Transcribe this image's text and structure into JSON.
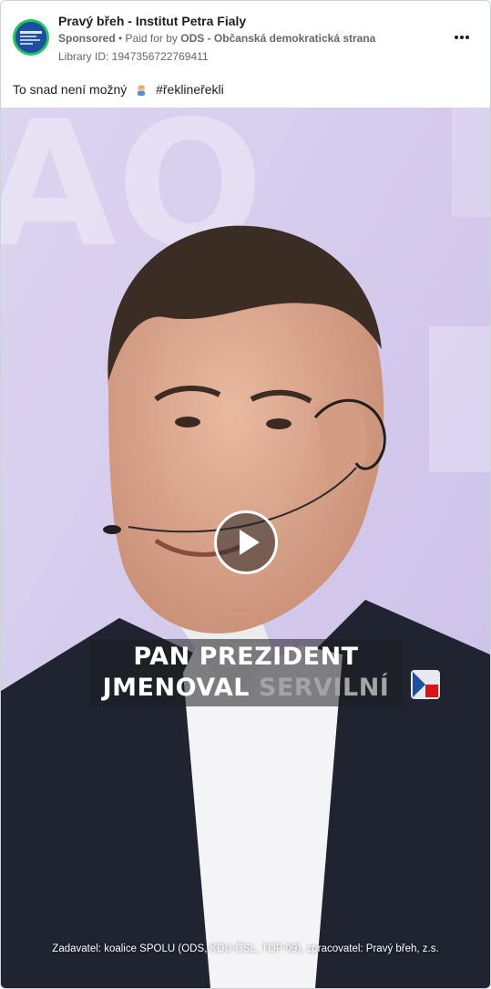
{
  "ad": {
    "page_name": "Pravý břeh - Institut Petra Fialy",
    "sponsored_label": "Sponsored",
    "separator": " • ",
    "paid_for_prefix": "Paid for by ",
    "payer": "ODS - Občanská demokratická strana",
    "library_id": "Library ID: 1947356722769411",
    "caption_text_before": "To snad není možný",
    "caption_hashtag": "#řeklineřekli"
  },
  "media": {
    "subtitle_line1": "PAN PREZIDENT",
    "subtitle_line2_main": "JMENOVAL ",
    "subtitle_line2_dim": "SERVILNÍ",
    "disclaimer": "Zadavatel: koalice SPOLU (ODS, KDU-ČSL, TOP 09), zpracovatel: Pravý břeh, z.s."
  },
  "icons": {
    "avatar": "page-logo",
    "more": "more-options-icon",
    "play": "play-icon",
    "emoji": "facepalm-emoji"
  },
  "colors": {
    "avatar_ring": "#22c55e",
    "avatar_fill": "#1d4ea1",
    "background_purple": "#d9d0ee",
    "jacket": "#1f2430",
    "shirt": "#f4f3f6"
  }
}
